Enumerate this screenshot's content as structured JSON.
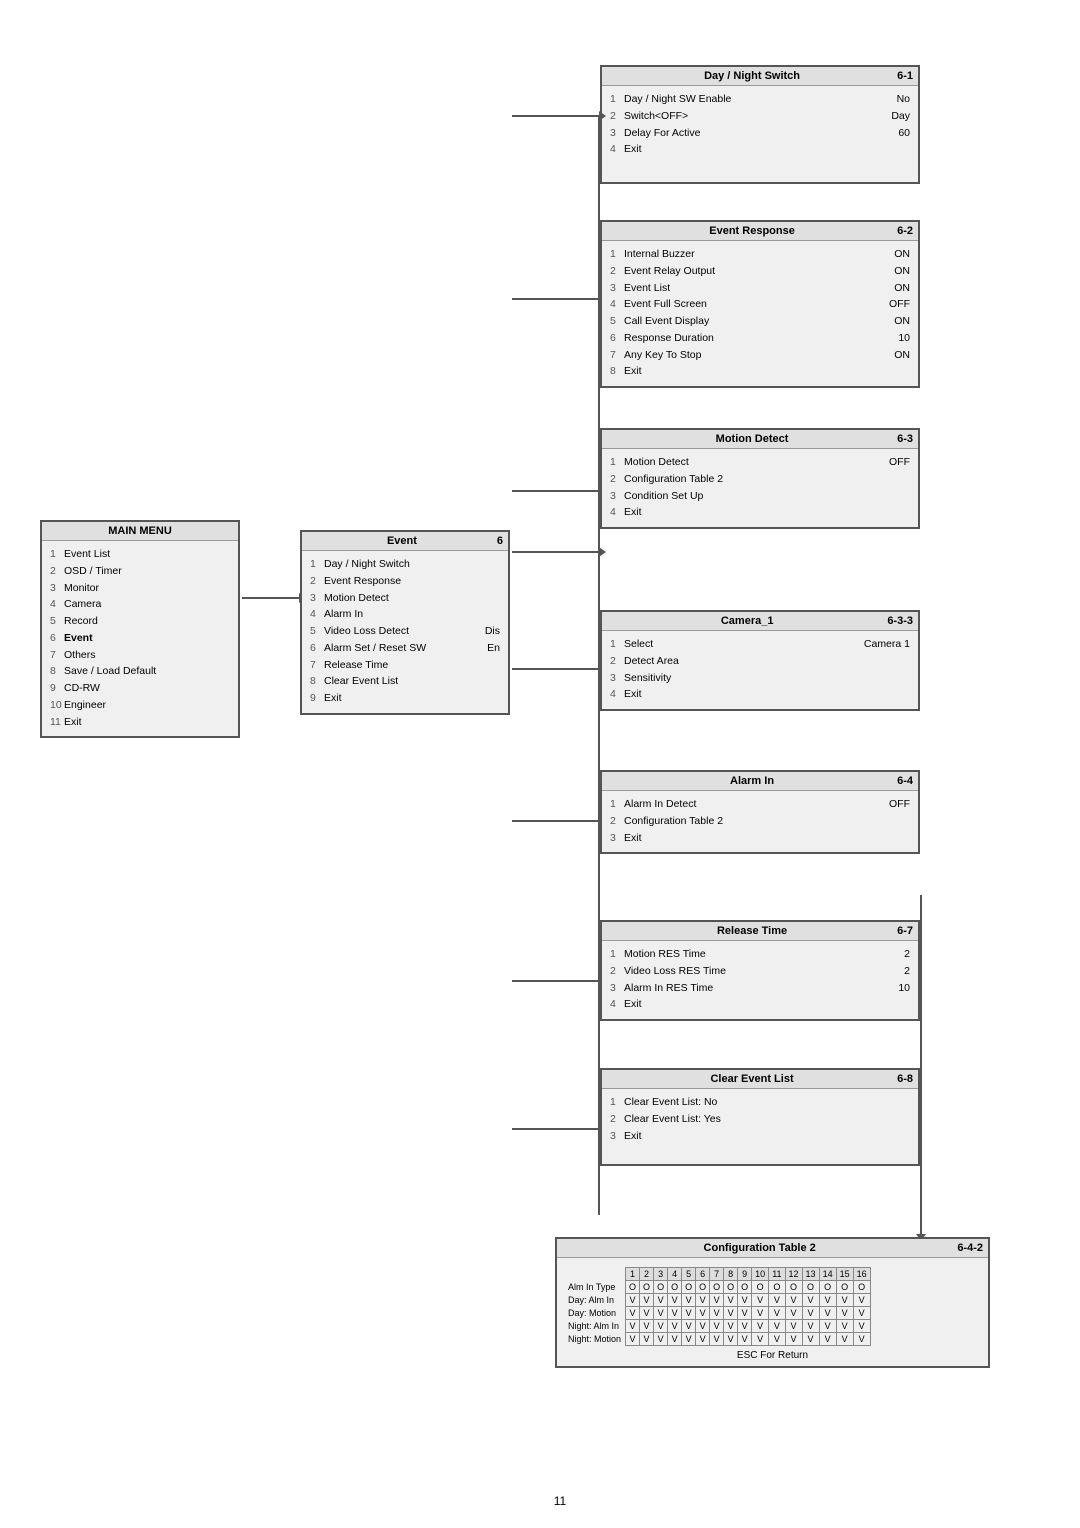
{
  "page": {
    "number": "11",
    "background": "#ffffff"
  },
  "main_menu": {
    "title": "MAIN MENU",
    "items": [
      {
        "num": "1",
        "label": "Event List",
        "bold": false
      },
      {
        "num": "2",
        "label": "OSD / Timer",
        "bold": false
      },
      {
        "num": "3",
        "label": "Monitor",
        "bold": false
      },
      {
        "num": "4",
        "label": "Camera",
        "bold": false
      },
      {
        "num": "5",
        "label": "Record",
        "bold": false
      },
      {
        "num": "6",
        "label": "Event",
        "bold": true
      },
      {
        "num": "7",
        "label": "Others",
        "bold": false
      },
      {
        "num": "8",
        "label": "Save / Load Default",
        "bold": false
      },
      {
        "num": "9",
        "label": "CD-RW",
        "bold": false
      },
      {
        "num": "10",
        "label": "Engineer",
        "bold": false
      },
      {
        "num": "11",
        "label": "Exit",
        "bold": false
      }
    ]
  },
  "event_menu": {
    "title": "Event",
    "number": "6",
    "items": [
      {
        "num": "1",
        "label": "Day / Night Switch",
        "val": ""
      },
      {
        "num": "2",
        "label": "Event Response",
        "val": ""
      },
      {
        "num": "3",
        "label": "Motion Detect",
        "val": ""
      },
      {
        "num": "4",
        "label": "Alarm In",
        "val": ""
      },
      {
        "num": "5",
        "label": "Video Loss Detect",
        "val": "Dis"
      },
      {
        "num": "6",
        "label": "Alarm Set / Reset SW",
        "val": "En"
      },
      {
        "num": "7",
        "label": "Release Time",
        "val": ""
      },
      {
        "num": "8",
        "label": "Clear Event List",
        "val": ""
      },
      {
        "num": "9",
        "label": "Exit",
        "val": ""
      }
    ]
  },
  "day_night": {
    "title": "Day / Night Switch",
    "number": "6-1",
    "items": [
      {
        "num": "1",
        "label": "Day / Night SW Enable",
        "val": "No"
      },
      {
        "num": "2",
        "label": "Switch<OFF>",
        "val": "Day"
      },
      {
        "num": "3",
        "label": "Delay For Active",
        "val": "60"
      },
      {
        "num": "4",
        "label": "Exit",
        "val": ""
      }
    ]
  },
  "event_response": {
    "title": "Event Response",
    "number": "6-2",
    "items": [
      {
        "num": "1",
        "label": "Internal Buzzer",
        "val": "ON"
      },
      {
        "num": "2",
        "label": "Event Relay Output",
        "val": "ON"
      },
      {
        "num": "3",
        "label": "Event List",
        "val": "ON"
      },
      {
        "num": "4",
        "label": "Event Full Screen",
        "val": "OFF"
      },
      {
        "num": "5",
        "label": "Call Event Display",
        "val": "ON"
      },
      {
        "num": "6",
        "label": "Response Duration",
        "val": "10"
      },
      {
        "num": "7",
        "label": "Any Key To Stop",
        "val": "ON"
      },
      {
        "num": "8",
        "label": "Exit",
        "val": ""
      }
    ]
  },
  "motion_detect": {
    "title": "Motion Detect",
    "number": "6-3",
    "items": [
      {
        "num": "1",
        "label": "Motion Detect",
        "val": "OFF"
      },
      {
        "num": "2",
        "label": "Configuration Table 2",
        "val": ""
      },
      {
        "num": "3",
        "label": "Condition Set Up",
        "val": ""
      },
      {
        "num": "4",
        "label": "Exit",
        "val": ""
      }
    ]
  },
  "camera1": {
    "title": "Camera_1",
    "number": "6-3-3",
    "items": [
      {
        "num": "1",
        "label": "Select",
        "val": "Camera 1"
      },
      {
        "num": "2",
        "label": "Detect Area",
        "val": ""
      },
      {
        "num": "3",
        "label": "Sensitivity",
        "val": ""
      },
      {
        "num": "4",
        "label": "Exit",
        "val": ""
      }
    ]
  },
  "alarm_in": {
    "title": "Alarm In",
    "number": "6-4",
    "items": [
      {
        "num": "1",
        "label": "Alarm In Detect",
        "val": "OFF"
      },
      {
        "num": "2",
        "label": "Configuration Table 2",
        "val": ""
      },
      {
        "num": "3",
        "label": "Exit",
        "val": ""
      }
    ]
  },
  "release_time": {
    "title": "Release Time",
    "number": "6-7",
    "items": [
      {
        "num": "1",
        "label": "Motion RES Time",
        "val": "2"
      },
      {
        "num": "2",
        "label": "Video Loss RES Time",
        "val": "2"
      },
      {
        "num": "3",
        "label": "Alarm In RES Time",
        "val": "10"
      },
      {
        "num": "4",
        "label": "Exit",
        "val": ""
      }
    ]
  },
  "clear_event": {
    "title": "Clear Event List",
    "number": "6-8",
    "items": [
      {
        "num": "1",
        "label": "Clear Event List: No",
        "val": ""
      },
      {
        "num": "2",
        "label": "Clear Event List: Yes",
        "val": ""
      },
      {
        "num": "3",
        "label": "Exit",
        "val": ""
      }
    ]
  },
  "config_table": {
    "title": "Configuration Table 2",
    "number": "6-4-2",
    "columns": [
      "1",
      "2",
      "3",
      "4",
      "5",
      "6",
      "7",
      "8",
      "9",
      "10",
      "11",
      "12",
      "13",
      "14",
      "15",
      "16"
    ],
    "rows": [
      {
        "label": "Alm In Type",
        "values": [
          "O",
          "O",
          "O",
          "O",
          "O",
          "O",
          "O",
          "O",
          "O",
          "O",
          "O",
          "O",
          "O",
          "O",
          "O",
          "O"
        ]
      },
      {
        "label": "Day: Alm In",
        "values": [
          "V",
          "V",
          "V",
          "V",
          "V",
          "V",
          "V",
          "V",
          "V",
          "V",
          "V",
          "V",
          "V",
          "V",
          "V",
          "V"
        ]
      },
      {
        "label": "Day: Motion",
        "values": [
          "V",
          "V",
          "V",
          "V",
          "V",
          "V",
          "V",
          "V",
          "V",
          "V",
          "V",
          "V",
          "V",
          "V",
          "V",
          "V"
        ]
      },
      {
        "label": "Night: Alm In",
        "values": [
          "V",
          "V",
          "V",
          "V",
          "V",
          "V",
          "V",
          "V",
          "V",
          "V",
          "V",
          "V",
          "V",
          "V",
          "V",
          "V"
        ]
      },
      {
        "label": "Night: Motion",
        "values": [
          "V",
          "V",
          "V",
          "V",
          "V",
          "V",
          "V",
          "V",
          "V",
          "V",
          "V",
          "V",
          "V",
          "V",
          "V",
          "V"
        ]
      }
    ],
    "esc_label": "ESC For Return"
  }
}
